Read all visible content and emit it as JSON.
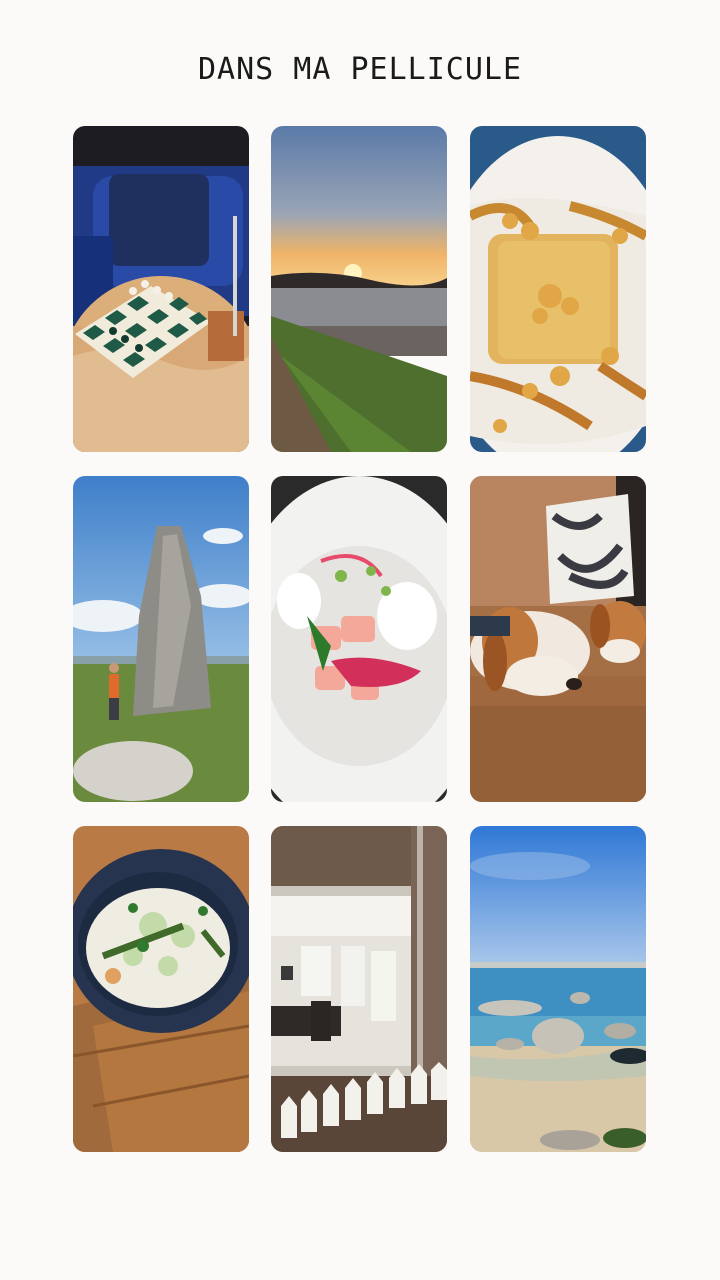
{
  "page": {
    "title": "DANS MA PELLICULE"
  },
  "photos": [
    {
      "subject": "chess-board-armchair"
    },
    {
      "subject": "sunset-over-bay"
    },
    {
      "subject": "dessert-with-caramel"
    },
    {
      "subject": "hiker-at-menhir"
    },
    {
      "subject": "plated-raw-fish-dish"
    },
    {
      "subject": "sleeping-beagles-on-sofa"
    },
    {
      "subject": "soup-bowl-on-wooden-board"
    },
    {
      "subject": "restaurant-mirror-miniature-houses"
    },
    {
      "subject": "rocky-beach-blue-sky"
    }
  ]
}
